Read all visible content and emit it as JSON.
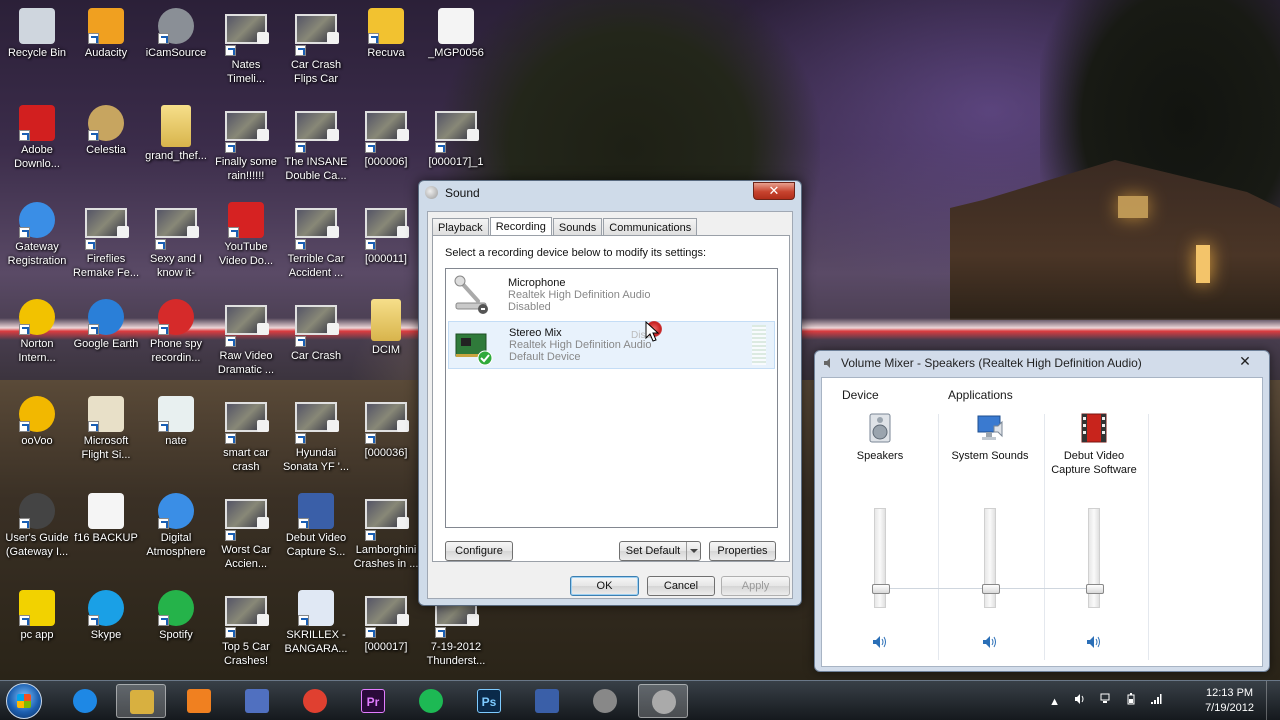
{
  "desktop": {
    "icons": [
      {
        "label": "Recycle Bin"
      },
      {
        "label": "Audacity"
      },
      {
        "label": "iCamSource"
      },
      {
        "label": "Nates\nTimeli..."
      },
      {
        "label": "Car Crash\nFlips Car"
      },
      {
        "label": "Recuva"
      },
      {
        "label": "_MGP0056"
      },
      {
        "label": "Adobe\nDownlo..."
      },
      {
        "label": "Celestia"
      },
      {
        "label": "grand_thef..."
      },
      {
        "label": "Finally some\nrain!!!!!!"
      },
      {
        "label": "The INSANE\nDouble Ca..."
      },
      {
        "label": "[000006]"
      },
      {
        "label": "[000017]_1"
      },
      {
        "label": "Gateway\nRegistration"
      },
      {
        "label": "Fireflies\nRemake Fe..."
      },
      {
        "label": "Sexy and I\nknow it-"
      },
      {
        "label": "YouTube\nVideo Do..."
      },
      {
        "label": "Terrible Car\nAccident ..."
      },
      {
        "label": "[000011]"
      },
      {
        "label": "Norton\nIntern..."
      },
      {
        "label": "Google Earth"
      },
      {
        "label": "Phone spy\nrecordin..."
      },
      {
        "label": "Raw Video\nDramatic ..."
      },
      {
        "label": "Car Crash"
      },
      {
        "label": "DCIM"
      },
      {
        "label": "ooVoo"
      },
      {
        "label": "Microsoft\nFlight Si..."
      },
      {
        "label": "nate"
      },
      {
        "label": "smart car\ncrash"
      },
      {
        "label": "Hyundai\nSonata YF '..."
      },
      {
        "label": "[000036]"
      },
      {
        "label": "User's Guide\n(Gateway I..."
      },
      {
        "label": "f16 BACKUP"
      },
      {
        "label": "Digital\nAtmosphere"
      },
      {
        "label": "Worst Car\nAccien..."
      },
      {
        "label": "Debut Video\nCapture S..."
      },
      {
        "label": "Lamborghini\nCrashes in ..."
      },
      {
        "label": "pc app"
      },
      {
        "label": "Skype"
      },
      {
        "label": "Spotify"
      },
      {
        "label": "Top 5 Car\nCrashes!"
      },
      {
        "label": "SKRILLEX -\nBANGARA..."
      },
      {
        "label": "[000017]"
      },
      {
        "label": "7-19-2012\nThunderst..."
      }
    ]
  },
  "sound_dialog": {
    "title": "Sound",
    "close": "✕",
    "tabs": [
      {
        "label": "Playback",
        "active": false
      },
      {
        "label": "Recording",
        "active": true
      },
      {
        "label": "Sounds",
        "active": false
      },
      {
        "label": "Communications",
        "active": false
      }
    ],
    "instructions": "Select a recording device below to modify its settings:",
    "devices": [
      {
        "name": "Microphone",
        "driver": "Realtek High Definition Audio",
        "status": "Disabled",
        "selected": false
      },
      {
        "name": "Stereo Mix",
        "driver": "Realtek High Definition Audio",
        "status": "Default Device",
        "selected": true,
        "drag_ghost": "Disa"
      }
    ],
    "buttons": {
      "configure": "Configure",
      "set_default": "Set Default",
      "properties": "Properties",
      "ok": "OK",
      "cancel": "Cancel",
      "apply": "Apply"
    }
  },
  "volume_mixer": {
    "title": "Volume Mixer - Speakers (Realtek High Definition Audio)",
    "close": "✕",
    "device_header": "Device",
    "applications_header": "Applications",
    "channels": [
      {
        "name": "Speakers",
        "level": 0.2
      },
      {
        "name": "System Sounds",
        "level": 0.2
      },
      {
        "name": "Debut Video\nCapture Software",
        "level": 0.2
      }
    ]
  },
  "taskbar": {
    "clock_time": "12:13 PM",
    "clock_date": "7/19/2012",
    "tray_expand": "▲",
    "pinned": [
      {
        "name": "internet-explorer"
      },
      {
        "name": "file-explorer"
      },
      {
        "name": "media-player"
      },
      {
        "name": "paint-tool"
      },
      {
        "name": "chrome"
      },
      {
        "name": "premiere",
        "glyph": "Pr"
      },
      {
        "name": "spotify"
      },
      {
        "name": "photoshop",
        "glyph": "Ps"
      },
      {
        "name": "debut-video"
      },
      {
        "name": "sound-speaker-1"
      },
      {
        "name": "sound-speaker-2"
      }
    ]
  },
  "colors": {
    "accent": "#3c7fb1",
    "dialog_frame": "#cfdbe9",
    "close_red": "#c7432e"
  }
}
